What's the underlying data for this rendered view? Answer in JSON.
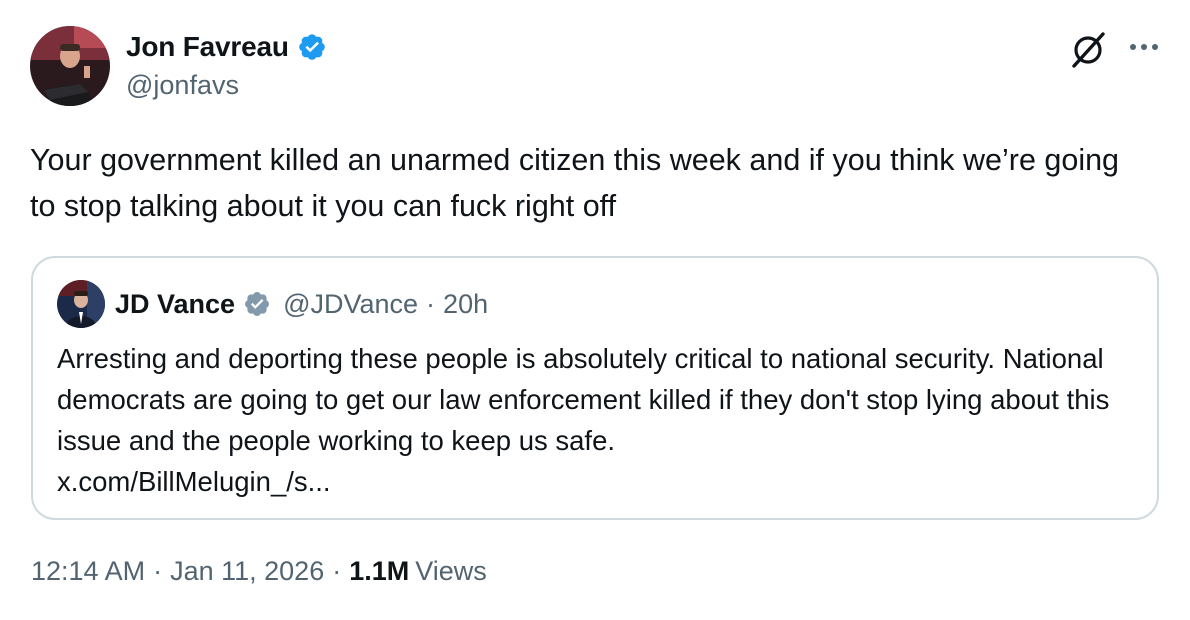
{
  "author": {
    "name": "Jon Favreau",
    "handle": "@jonfavs"
  },
  "tweet": {
    "text": "Your government killed an unarmed citizen this week and if you think we’re going to stop talking about it you can fuck right off"
  },
  "quoted": {
    "name": "JD Vance",
    "handle": "@JDVance",
    "separator": "·",
    "time": "20h",
    "text": "Arresting and deporting these people is absolutely critical to national security. National democrats are going to get our law enforcement killed if they don't stop lying about this issue and the people working to keep us safe.",
    "link": "x.com/BillMelugin_/s..."
  },
  "meta": {
    "time": "12:14 AM",
    "separator": "·",
    "date": "Jan 11, 2026",
    "views_count": "1.1M",
    "views_label": "Views"
  },
  "colors": {
    "verified_blue": "#1d9bf0",
    "government_gray": "#829aab",
    "secondary_text": "#536471",
    "border": "#cfd9de"
  },
  "icons": {
    "author_verified": "verified-badge-icon",
    "quoted_verified": "government-verified-badge-icon",
    "grok": "grok-icon",
    "more": "more-options-icon"
  }
}
